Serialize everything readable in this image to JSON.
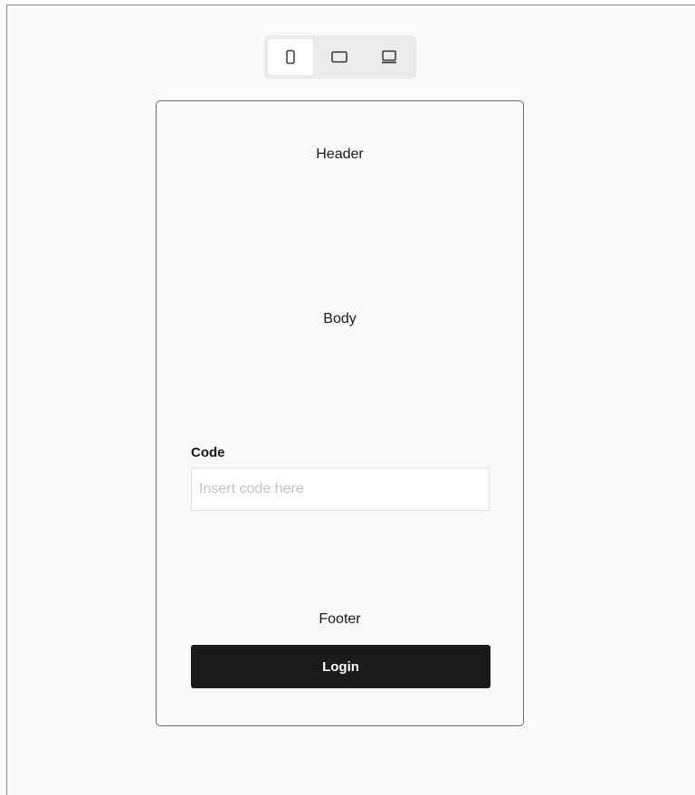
{
  "device_switcher": {
    "options": [
      {
        "icon": "mobile-icon",
        "active": true
      },
      {
        "icon": "tablet-icon",
        "active": false
      },
      {
        "icon": "laptop-icon",
        "active": false
      }
    ]
  },
  "preview": {
    "header_label": "Header",
    "body_label": "Body",
    "footer_label": "Footer",
    "code_field": {
      "label": "Code",
      "placeholder": "Insert code here",
      "value": ""
    },
    "login_button": "Login"
  },
  "colors": {
    "canvas_bg": "#f9f9f9",
    "switcher_bg": "#ebebeb",
    "button_bg": "#1b1b1b",
    "button_text": "#ffffff"
  }
}
